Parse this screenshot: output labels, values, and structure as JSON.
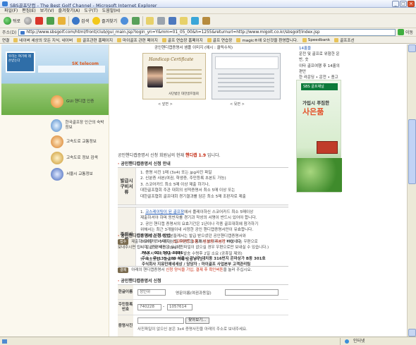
{
  "window": {
    "title": "SBS골프닷컴 - The Best Golf Channel - Microsoft Internet Explorer",
    "controls": [
      "_",
      "□",
      "×"
    ]
  },
  "menu": [
    "파일(F)",
    "편집(E)",
    "보기(V)",
    "즐겨찾기(A)",
    "도구(T)",
    "도움말(H)"
  ],
  "toolbar": {
    "back": "뒤로",
    "search": "검색",
    "favorites": "즐겨찾기"
  },
  "address": {
    "label": "주소(D)",
    "url": "http://www.sbsgolf.com/html/front/club/gui_main.jsp?login_yn=Y&mm=01_05_00&h=1255&returnurl=http://www.migolt.co.kr/sbsgolf/index.jsp",
    "go": "이동"
  },
  "links": {
    "label": "연결",
    "items": [
      "네이버 세상의 모든 지식, 네이버",
      "골프관련 홈페이지",
      "마이골프 관련 페이지",
      "골프 연습장 홈페이지",
      "골프 연습장",
      "magic®에 오신것을 환영합니다.",
      "Speedbank",
      "골프조선"
    ]
  },
  "left": {
    "banner_caption": "우리는 여기에 레슨받는다",
    "banner_brand": "SK telecom",
    "menu": [
      "GUI 핸디캡 인증",
      "한국골프장 인근의 숙박정보",
      "고속도로 교통정보",
      "고속도로 정보 검색",
      "서울시 교통정보"
    ]
  },
  "main": {
    "sample_caption": "공인핸디캡증명서 샘플 이미지 (예시 : 클릭수치)",
    "cert_heading": "Handicap Certificate",
    "cert_footer": "사단법인 대한골프협회",
    "caption_front": "< 앞면 >",
    "caption_back": "< 뒷면 >",
    "price_prefix": "공인핸디캡증명서 신청",
    "price_mid": "회원님의 현재",
    "price_label": "핸디캡",
    "price_value": "1.9",
    "price_suffix": "입니다.",
    "section1_title": "공인핸디캡증명서 신청 안내",
    "box1_label": "발급시 구비서류",
    "box1_lines": [
      "1. 증명 사진 1매 (3x4) 또는 jpg사진 파일",
      "2. 신분증 사본(여권, 학생증, 주민등록 초본도 가능)",
      "3. 스코어카드 최소 5매 이상 제출 하기나,",
      "   대한골프협회 주관 대회의 성적증명서 최소 5매 이상 또는",
      "   대한골프협회 골프대회 경기결과를 담은 최소 5매 조판자로 제출"
    ],
    "box2_label": "주의사항",
    "box2_line1_pre": "1.",
    "box2_line1_link": "코스레이팅이 된 골프장",
    "box2_line1_post": "에서 플레이하신 스코어카드 최소 5매이상",
    "box2_lines": [
      "   제출하셔야 하며 동반자를 경기과 작성의 서명이 반드시 있어야 합니다.",
      "2. 공인 핸디캡 증명서의 요효기간은 1년이나 각종 골프대회에 참가하기",
      "   위해서는 최근 3개월이내 사정한 공인 핸디캡증명서만이 유효합니다.",
      "3. 재발급 하시는 분들께서는 발급 받으셨던 공인핸디캡증명서와",
      "   스코어카드 5매 이상을 우편등을 통해서 보내주시기 바랍니다.",
      "4. 발급 및 배송 소요기간",
      "   - 방문시 즉시 발급 - 우편 발송 수령후 2일 소요 (공휴일 제외)",
      "5. 배송방법 - 발급 후 택배 발송 (착불)"
    ],
    "section2_title": "공인핸디캡증명서 신청 방법",
    "note1_tag": "접수",
    "note1_pre": "제출하셔야할 구비서류는",
    "note1_red": "스코어카드 5장",
    "note1_mid": "과",
    "note1_red2": "신분증 사본만",
    "note1_post": "FAX 또는 우편으로",
    "note1_line2": "보내주시면 됩니다. (증명사진은 jpg사진파일이 없으실 경우 우편으로만 보내실 수 있습니다.)",
    "fax": "FAX : 02) 501-8881",
    "addr": "주소 : 우)135-280 서울시 강남구 대치동 316번지 은마상가 B동 301호",
    "addr2": "주식회사 지유민에네세상 / 당당자 : 마이골프 사업본부 고객관리팀",
    "note2_tag": "결제",
    "note2_pre": "아래의 핸디캡증명서",
    "note2_red": "신청 양식을 기입, 결제 후 확인버튼",
    "note2_post": "을 눌러 주십시요.",
    "section3_title": "공인핸디캡증명서 신청",
    "form": {
      "name_label": "한글이름",
      "name_value": "정인하",
      "en_label": "영문이름(여권과동일)",
      "rrn_label": "주민등록번호",
      "rrn1": "740228",
      "rrn2": "1057614",
      "photo_label": "증명사진",
      "browse": "찾아보기...",
      "photo_note": "사진파일이 없으신 분은 3x4 증명사진을 아래의 주소로 보내주세요."
    }
  },
  "right": {
    "text_lines": [
      "14홀을",
      "운전 및 골프로 위험한 운반, 숫",
      "이타 골프여행 후 14홀의 편안",
      "한 라운딩 • 운전 • 종고로 예약"
    ],
    "ad_brand": "SBS 골프채널",
    "ad_line1": "가입시 푸짐한",
    "ad_line2": "사은품"
  },
  "status": {
    "left": "",
    "zone": "인터넷"
  }
}
